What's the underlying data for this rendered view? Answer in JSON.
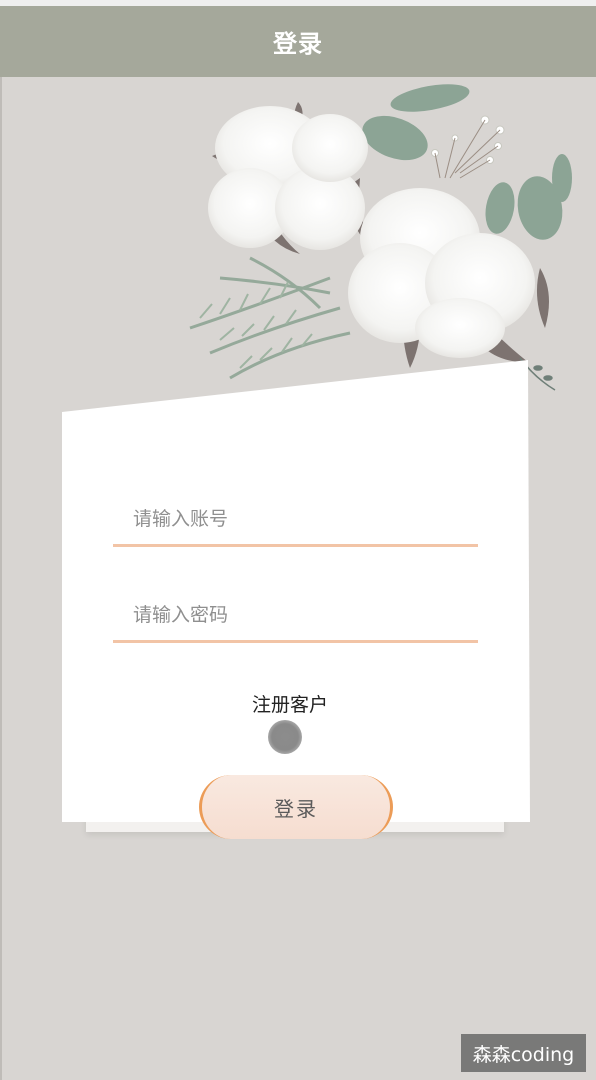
{
  "header": {
    "title": "登录"
  },
  "form": {
    "account_placeholder": "请输入账号",
    "password_placeholder": "请输入密码",
    "register_label": "注册客户",
    "login_label": "登录"
  },
  "watermark": {
    "text": "森森coding"
  },
  "colors": {
    "header_bg": "#a5a89b",
    "page_bg": "#d8d5d2",
    "input_underline": "#f2c4a6",
    "button_border": "#ec9c57"
  },
  "icons": {
    "illustration": "cotton-flower-illustration",
    "cursor": "touch-cursor-icon"
  }
}
